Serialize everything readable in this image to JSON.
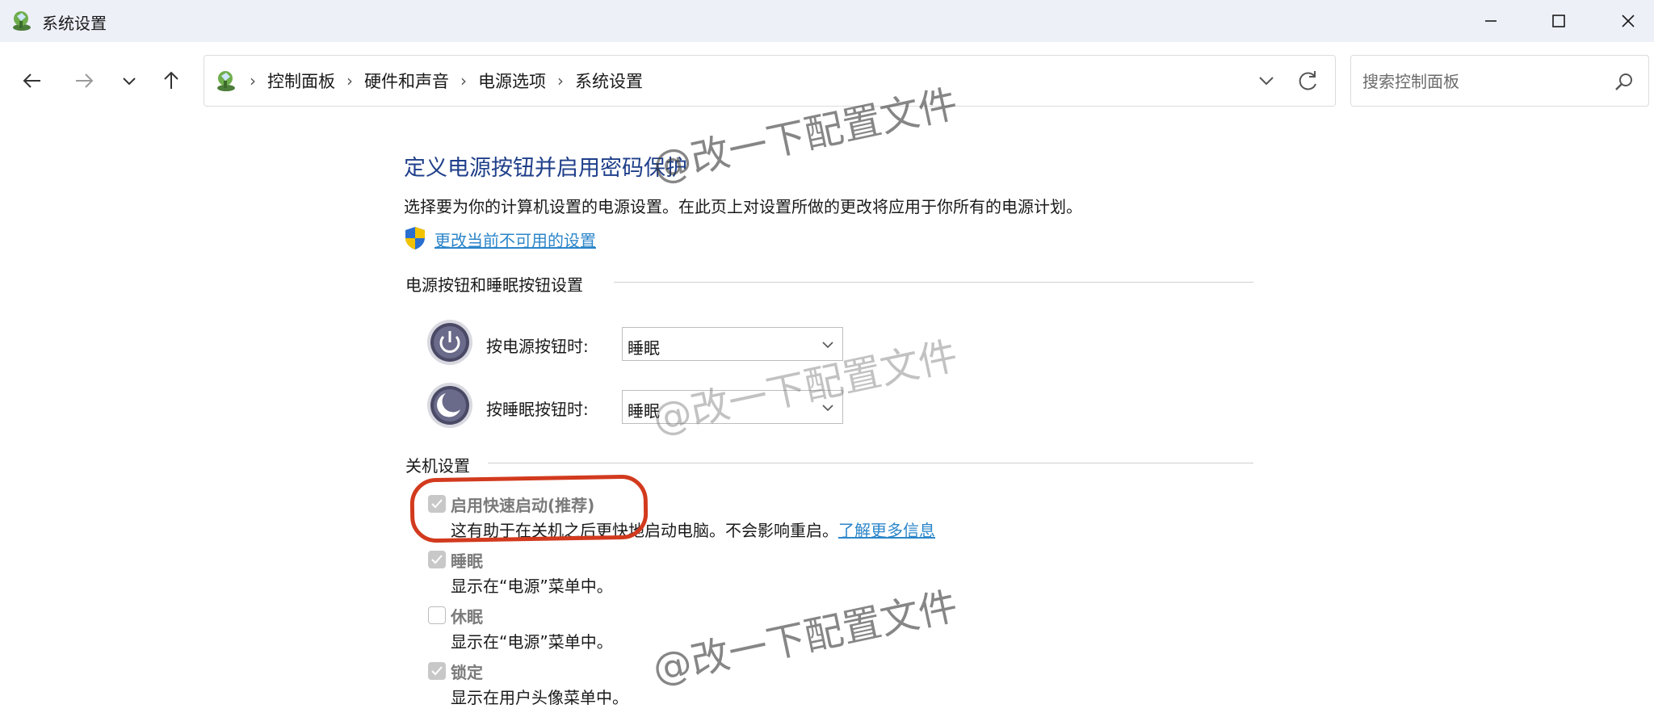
{
  "window": {
    "title": "系统设置"
  },
  "breadcrumb": {
    "items": [
      "控制面板",
      "硬件和声音",
      "电源选项",
      "系统设置"
    ]
  },
  "search": {
    "placeholder": "搜索控制面板",
    "value": ""
  },
  "main": {
    "title": "定义电源按钮并启用密码保护",
    "description": "选择要为你的计算机设置的电源设置。在此页上对设置所做的更改将应用于你所有的电源计划。",
    "change_link": "更改当前不可用的设置"
  },
  "buttons_section": {
    "header": "电源按钮和睡眠按钮设置",
    "power_label": "按电源按钮时:",
    "power_value": "睡眠",
    "sleep_label": "按睡眠按钮时:",
    "sleep_value": "睡眠"
  },
  "shutdown_section": {
    "header": "关机设置",
    "options": [
      {
        "label": "启用快速启动(推荐)",
        "checked": true,
        "description": "这有助于在关机之后更快地启动电脑。不会影响重启。",
        "link": "了解更多信息"
      },
      {
        "label": "睡眠",
        "checked": true,
        "description": "显示在“电源”菜单中。"
      },
      {
        "label": "休眠",
        "checked": false,
        "description": "显示在“电源”菜单中。"
      },
      {
        "label": "锁定",
        "checked": true,
        "description": "显示在用户头像菜单中。"
      }
    ]
  },
  "watermark": {
    "text": "@改一下配置文件"
  },
  "colors": {
    "title_blue": "#1f3f8a",
    "link_blue": "#2c86c9",
    "highlight_red": "#d23a1e",
    "titlebar_bg": "#eef0f8"
  }
}
